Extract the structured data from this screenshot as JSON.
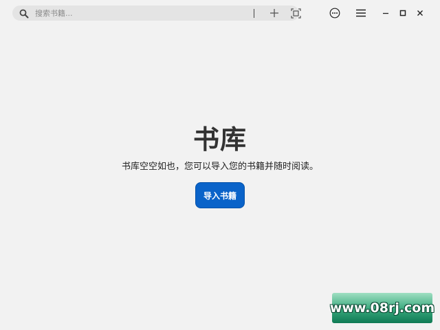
{
  "search": {
    "placeholder": "搜索书籍..."
  },
  "toolbar": {
    "add_icon": "plus-icon",
    "scan_icon": "scan-icon",
    "more_icon": "more-circle-icon",
    "menu_icon": "hamburger-icon",
    "minimize_icon": "minimize-icon",
    "maximize_icon": "maximize-icon",
    "close_icon": "close-icon"
  },
  "library": {
    "title": "书库",
    "description": "书库空空如也，您可以导入您的书籍并随时阅读。",
    "import_label": "导入书籍"
  },
  "watermark": {
    "text": "www.08rj.com"
  },
  "colors": {
    "background": "#f2f2f2",
    "search_bg": "#e4e4e4",
    "accent": "#0a63c9"
  }
}
